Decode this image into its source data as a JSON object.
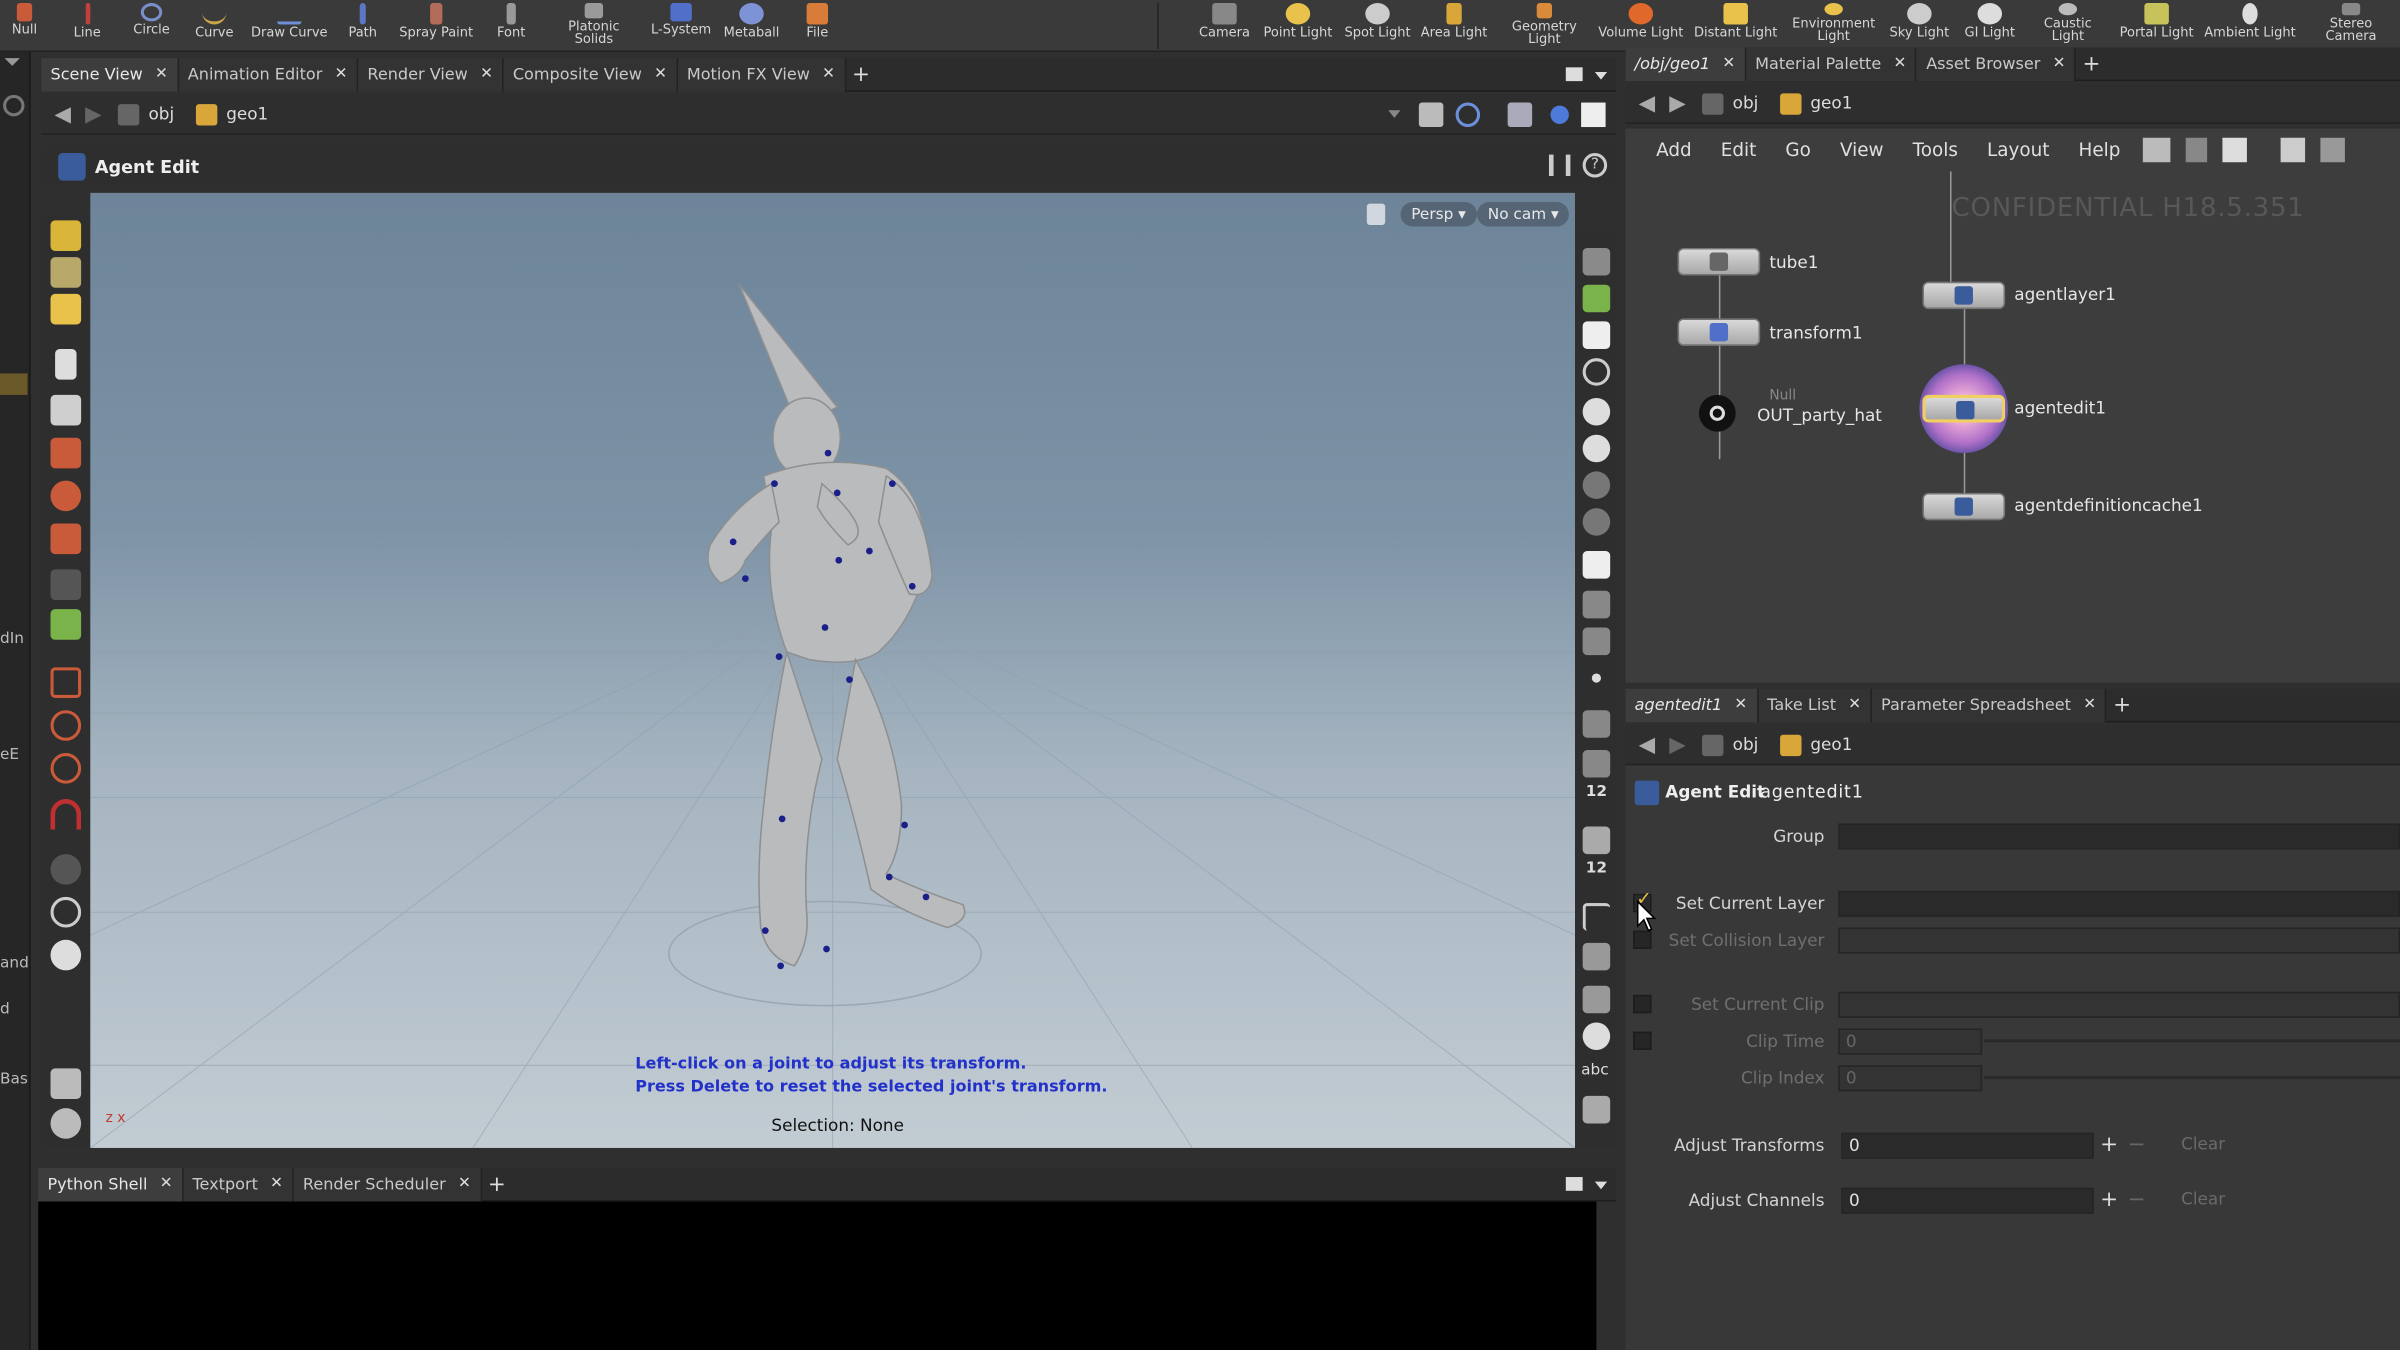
{
  "shelf": {
    "tools": [
      "Null",
      "Line",
      "Circle",
      "Curve",
      "Draw Curve",
      "Path",
      "Spray Paint",
      "Font",
      "Platonic Solids",
      "L-System",
      "Metaball",
      "File"
    ],
    "lights": [
      "Camera",
      "Point Light",
      "Spot Light",
      "Area Light",
      "Geometry Light",
      "Volume Light",
      "Distant Light",
      "Environment Light",
      "Sky Light",
      "GI Light",
      "Caustic Light",
      "Portal Light",
      "Ambient Light",
      "Stereo Camera"
    ]
  },
  "left_strip": {
    "fragments": [
      "dIn",
      "eE",
      "and",
      "d",
      "Bas"
    ]
  },
  "viewer_tabs": [
    {
      "label": "Scene View"
    },
    {
      "label": "Animation Editor"
    },
    {
      "label": "Render View"
    },
    {
      "label": "Composite View"
    },
    {
      "label": "Motion FX View"
    }
  ],
  "viewer_path": {
    "obj": "obj",
    "geo": "geo1"
  },
  "tool_header": {
    "title": "Agent Edit"
  },
  "viewport": {
    "persp": "Persp",
    "camera": "No cam",
    "hint_line1": "Left-click on a joint to adjust its transform.",
    "hint_line2": "Press Delete to reset the selected joint's transform.",
    "selection": "Selection: None",
    "axis": "z x"
  },
  "bottom_tabs": [
    {
      "label": "Python Shell"
    },
    {
      "label": "Textport"
    },
    {
      "label": "Render Scheduler"
    }
  ],
  "network_tabs": [
    {
      "label": "/obj/geo1"
    },
    {
      "label": "Material Palette"
    },
    {
      "label": "Asset Browser"
    }
  ],
  "network_path": {
    "obj": "obj",
    "geo": "geo1"
  },
  "network_menu": [
    "Add",
    "Edit",
    "Go",
    "View",
    "Tools",
    "Layout",
    "Help"
  ],
  "watermark": "CONFIDENTIAL H18.5.351",
  "nodes": {
    "tube": "tube1",
    "transform": "transform1",
    "null_type": "Null",
    "null_name": "OUT_party_hat",
    "agentlayer": "agentlayer1",
    "agentedit": "agentedit1",
    "agentdefcache": "agentdefinitioncache1"
  },
  "parm_tabs": [
    {
      "label": "agentedit1"
    },
    {
      "label": "Take List"
    },
    {
      "label": "Parameter Spreadsheet"
    }
  ],
  "parm_path": {
    "obj": "obj",
    "geo": "geo1"
  },
  "parms": {
    "node_type": "Agent Edit",
    "node_name": "agentedit1",
    "group_label": "Group",
    "set_current_layer": "Set Current Layer",
    "set_collision_layer": "Set Collision Layer",
    "set_current_clip": "Set Current Clip",
    "clip_time_label": "Clip Time",
    "clip_time_value": "0",
    "clip_index_label": "Clip Index",
    "clip_index_value": "0",
    "adjust_transforms_label": "Adjust Transforms",
    "adjust_transforms_value": "0",
    "adjust_channels_label": "Adjust Channels",
    "adjust_channels_value": "0",
    "clear": "Clear"
  },
  "colors": {
    "accent_yellow": "#e8c24a",
    "hint_blue": "#2231c9",
    "joint_blue": "#1a1f8a",
    "selected_node": "#f0d060"
  }
}
